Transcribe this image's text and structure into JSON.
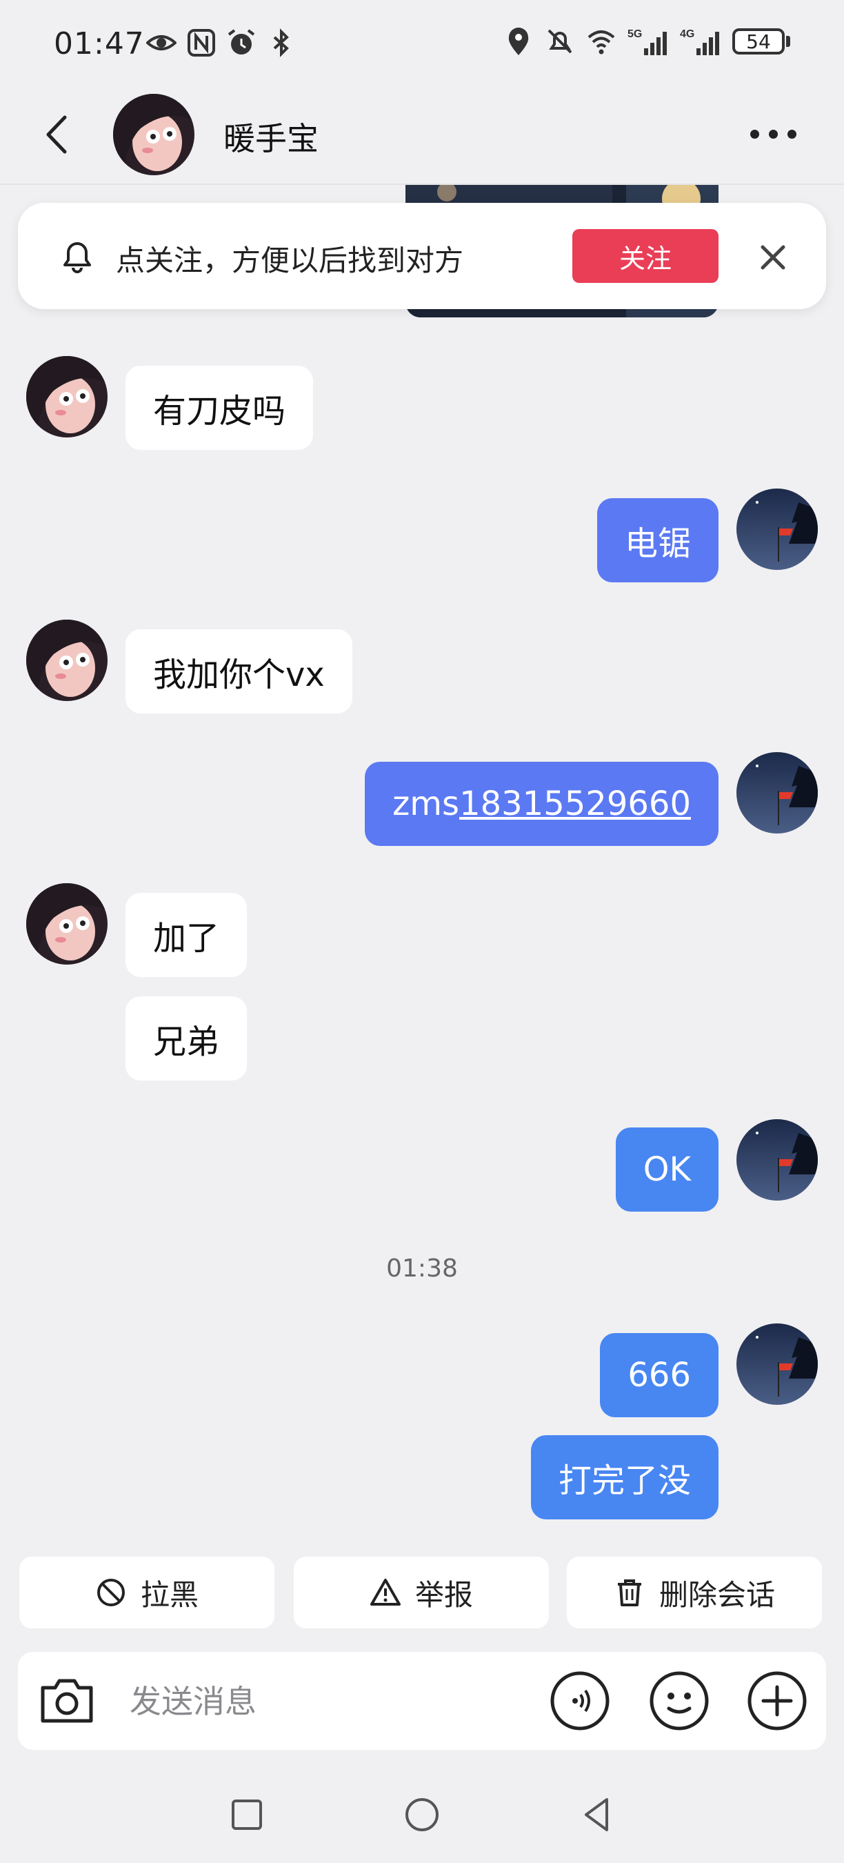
{
  "status_bar": {
    "time": "01:47",
    "battery": "54",
    "left_icons": [
      "eye-icon",
      "nfc-icon",
      "alarm-icon",
      "bluetooth-icon"
    ],
    "right_icons": [
      "location-icon",
      "mute-icon",
      "wifi-icon",
      "5g-signal-icon",
      "4g-signal-icon",
      "battery-icon"
    ]
  },
  "header": {
    "name": "暖手宝"
  },
  "follow_banner": {
    "text": "点关注，方便以后找到对方",
    "button_label": "关注",
    "accent": "#ea3e57"
  },
  "messages": [
    {
      "from": "other",
      "text": "有刀皮吗"
    },
    {
      "from": "me",
      "text": "电锯"
    },
    {
      "from": "other",
      "text": "我加你个vx"
    },
    {
      "from": "me",
      "text_prefix": "zms",
      "text_link": "18315529660"
    },
    {
      "from": "other",
      "text": "加了"
    },
    {
      "from": "other",
      "text": "兄弟"
    },
    {
      "from": "me",
      "text": "OK"
    },
    {
      "from": "system",
      "text": "01:38"
    },
    {
      "from": "me",
      "text": "666"
    },
    {
      "from": "me",
      "text": "打完了没"
    }
  ],
  "actions": {
    "block": "拉黑",
    "report": "举报",
    "delete": "删除会话"
  },
  "input": {
    "placeholder": "发送消息"
  },
  "colors": {
    "background": "#f0f0f2",
    "outgoing_bubble": "#5b79f3",
    "outgoing_bubble_alt": "#4886f2",
    "incoming_bubble": "#ffffff"
  }
}
